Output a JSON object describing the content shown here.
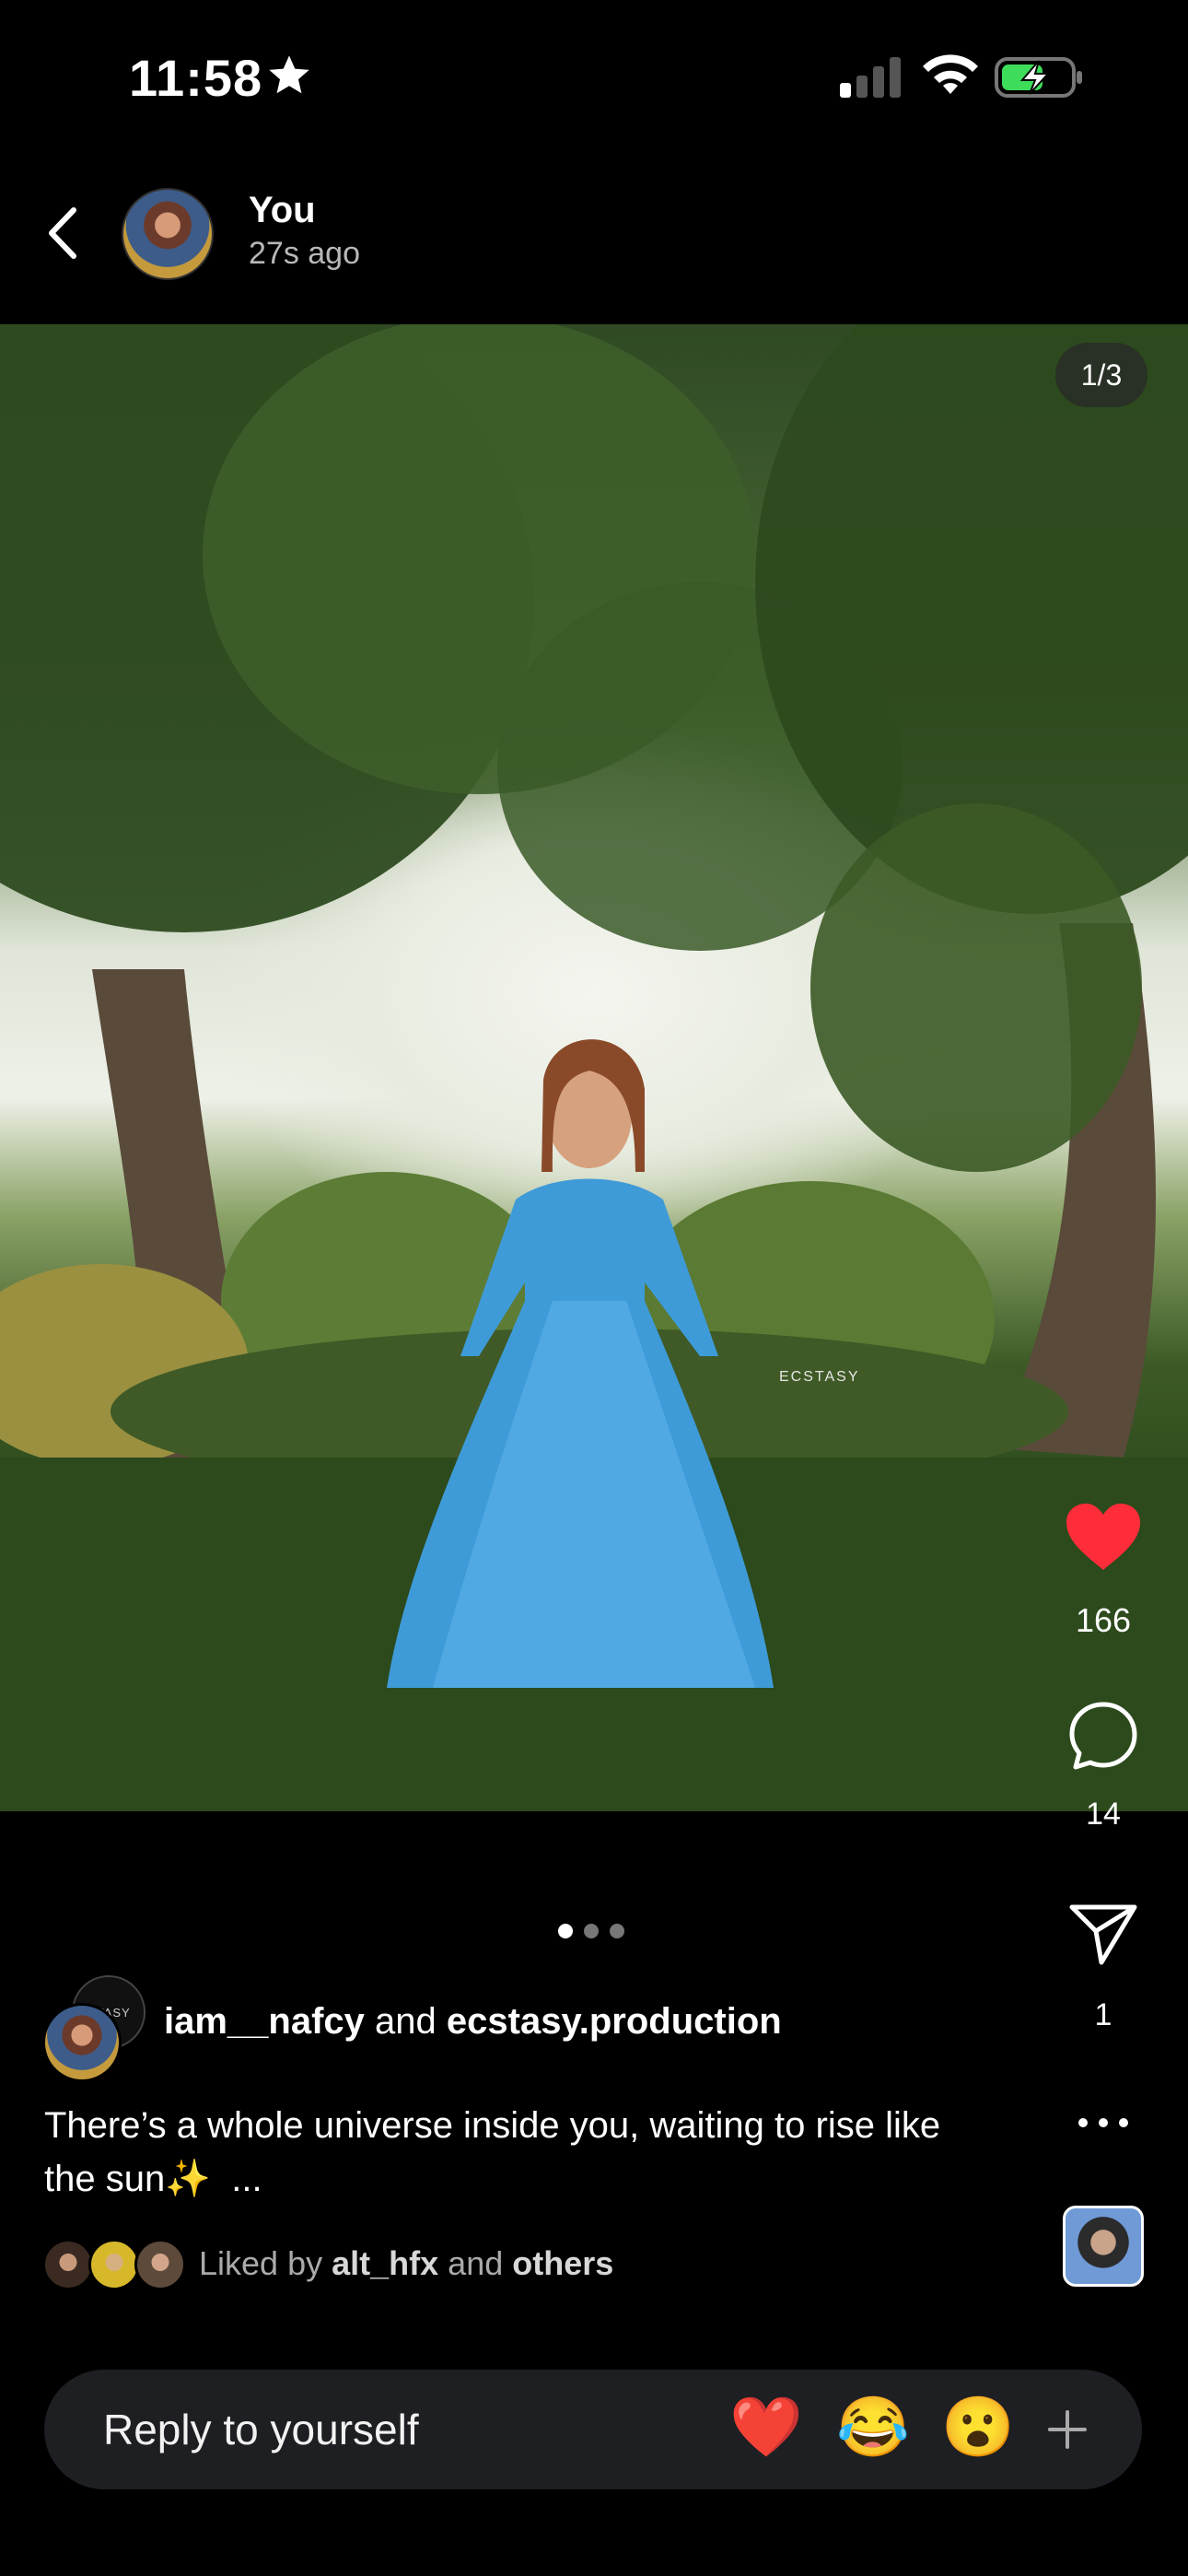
{
  "status_bar": {
    "time": "11:58"
  },
  "header": {
    "name": "You",
    "time_ago": "27s ago"
  },
  "post": {
    "image_counter": "1/3",
    "watermark": "ECSTASY",
    "likes": "166",
    "comments": "14",
    "shares": "1",
    "page_dots": 3,
    "active_dot": 0
  },
  "author": {
    "primary": "iam__nafcy",
    "connector": "and",
    "collaborator": "ecstasy.production",
    "collab_avatar_text": "CTASY"
  },
  "caption": {
    "text": "There’s a whole universe inside you, waiting to rise like the sun✨",
    "more": "..."
  },
  "liked_by": {
    "prefix": "Liked by",
    "user": "alt_hfx",
    "connector": "and",
    "others": "others"
  },
  "reply_bar": {
    "placeholder": "Reply to yourself",
    "reactions": [
      "❤️",
      "😂",
      "😮"
    ]
  },
  "colors": {
    "like_red": "#ff2d3a",
    "background": "#000000",
    "reply_bg": "#1e1f22"
  }
}
